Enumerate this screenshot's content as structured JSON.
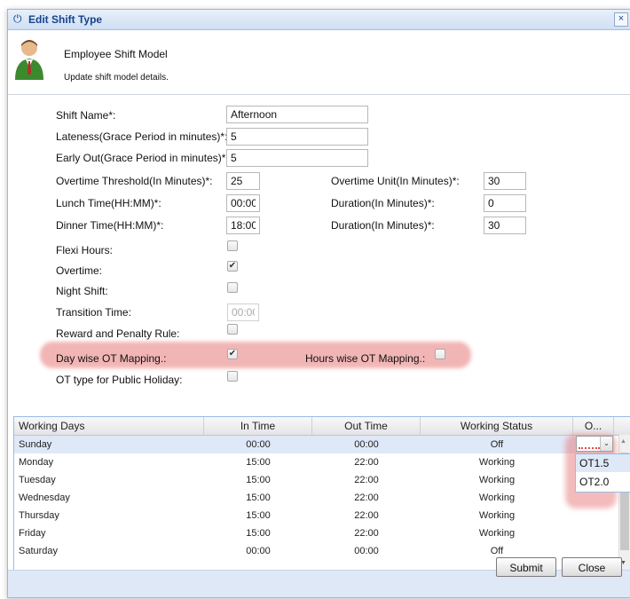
{
  "window": {
    "title": "Edit Shift Type",
    "close_glyph": "×"
  },
  "header": {
    "title": "Employee Shift Model",
    "subtitle": "Update shift model details."
  },
  "form": {
    "shift_name": {
      "label": "Shift Name*:",
      "value": "Afternoon"
    },
    "lateness": {
      "label": "Lateness(Grace Period in minutes)*:",
      "value": "5"
    },
    "early_out": {
      "label": "Early Out(Grace Period in minutes)*:",
      "value": "5"
    },
    "overtime_threshold": {
      "label": "Overtime Threshold(In Minutes)*:",
      "value": "25"
    },
    "overtime_unit": {
      "label": "Overtime Unit(In Minutes)*:",
      "value": "30"
    },
    "lunch_time": {
      "label": "Lunch Time(HH:MM)*:",
      "value": "00:00"
    },
    "lunch_duration": {
      "label": "Duration(In Minutes)*:",
      "value": "0"
    },
    "dinner_time": {
      "label": "Dinner Time(HH:MM)*:",
      "value": "18:00"
    },
    "dinner_duration": {
      "label": "Duration(In Minutes)*:",
      "value": "30"
    },
    "flexi_hours": {
      "label": "Flexi Hours:",
      "checked": false
    },
    "overtime": {
      "label": "Overtime:",
      "checked": true
    },
    "night_shift": {
      "label": "Night Shift:",
      "checked": false
    },
    "transition_time": {
      "label": "Transition Time:",
      "value": "00:00"
    },
    "reward_penalty": {
      "label": "Reward and Penalty Rule:",
      "checked": false
    },
    "day_wise_ot": {
      "label": "Day wise OT Mapping.:",
      "checked": true
    },
    "hours_wise_ot": {
      "label": "Hours wise OT Mapping.:",
      "checked": false
    },
    "ot_public_holiday": {
      "label": "OT type for Public Holiday:",
      "checked": false
    }
  },
  "grid": {
    "columns": [
      "Working Days",
      "In Time",
      "Out Time",
      "Working Status",
      "O..."
    ],
    "rows": [
      [
        "Sunday",
        "00:00",
        "00:00",
        "Off"
      ],
      [
        "Monday",
        "15:00",
        "22:00",
        "Working"
      ],
      [
        "Tuesday",
        "15:00",
        "22:00",
        "Working"
      ],
      [
        "Wednesday",
        "15:00",
        "22:00",
        "Working"
      ],
      [
        "Thursday",
        "15:00",
        "22:00",
        "Working"
      ],
      [
        "Friday",
        "15:00",
        "22:00",
        "Working"
      ],
      [
        "Saturday",
        "00:00",
        "00:00",
        "Off"
      ]
    ],
    "ot_dropdown": {
      "options": [
        "OT1.5",
        "OT2.0"
      ]
    }
  },
  "buttons": {
    "submit": "Submit",
    "close": "Close"
  },
  "icons": {
    "title": "power-icon",
    "check": "✔",
    "arrow_down": "⌄",
    "scroll_up": "▲",
    "scroll_down": "▼"
  },
  "colors": {
    "accent": "#15428b",
    "highlight": "#e87878",
    "selection": "#dfe8f6"
  }
}
